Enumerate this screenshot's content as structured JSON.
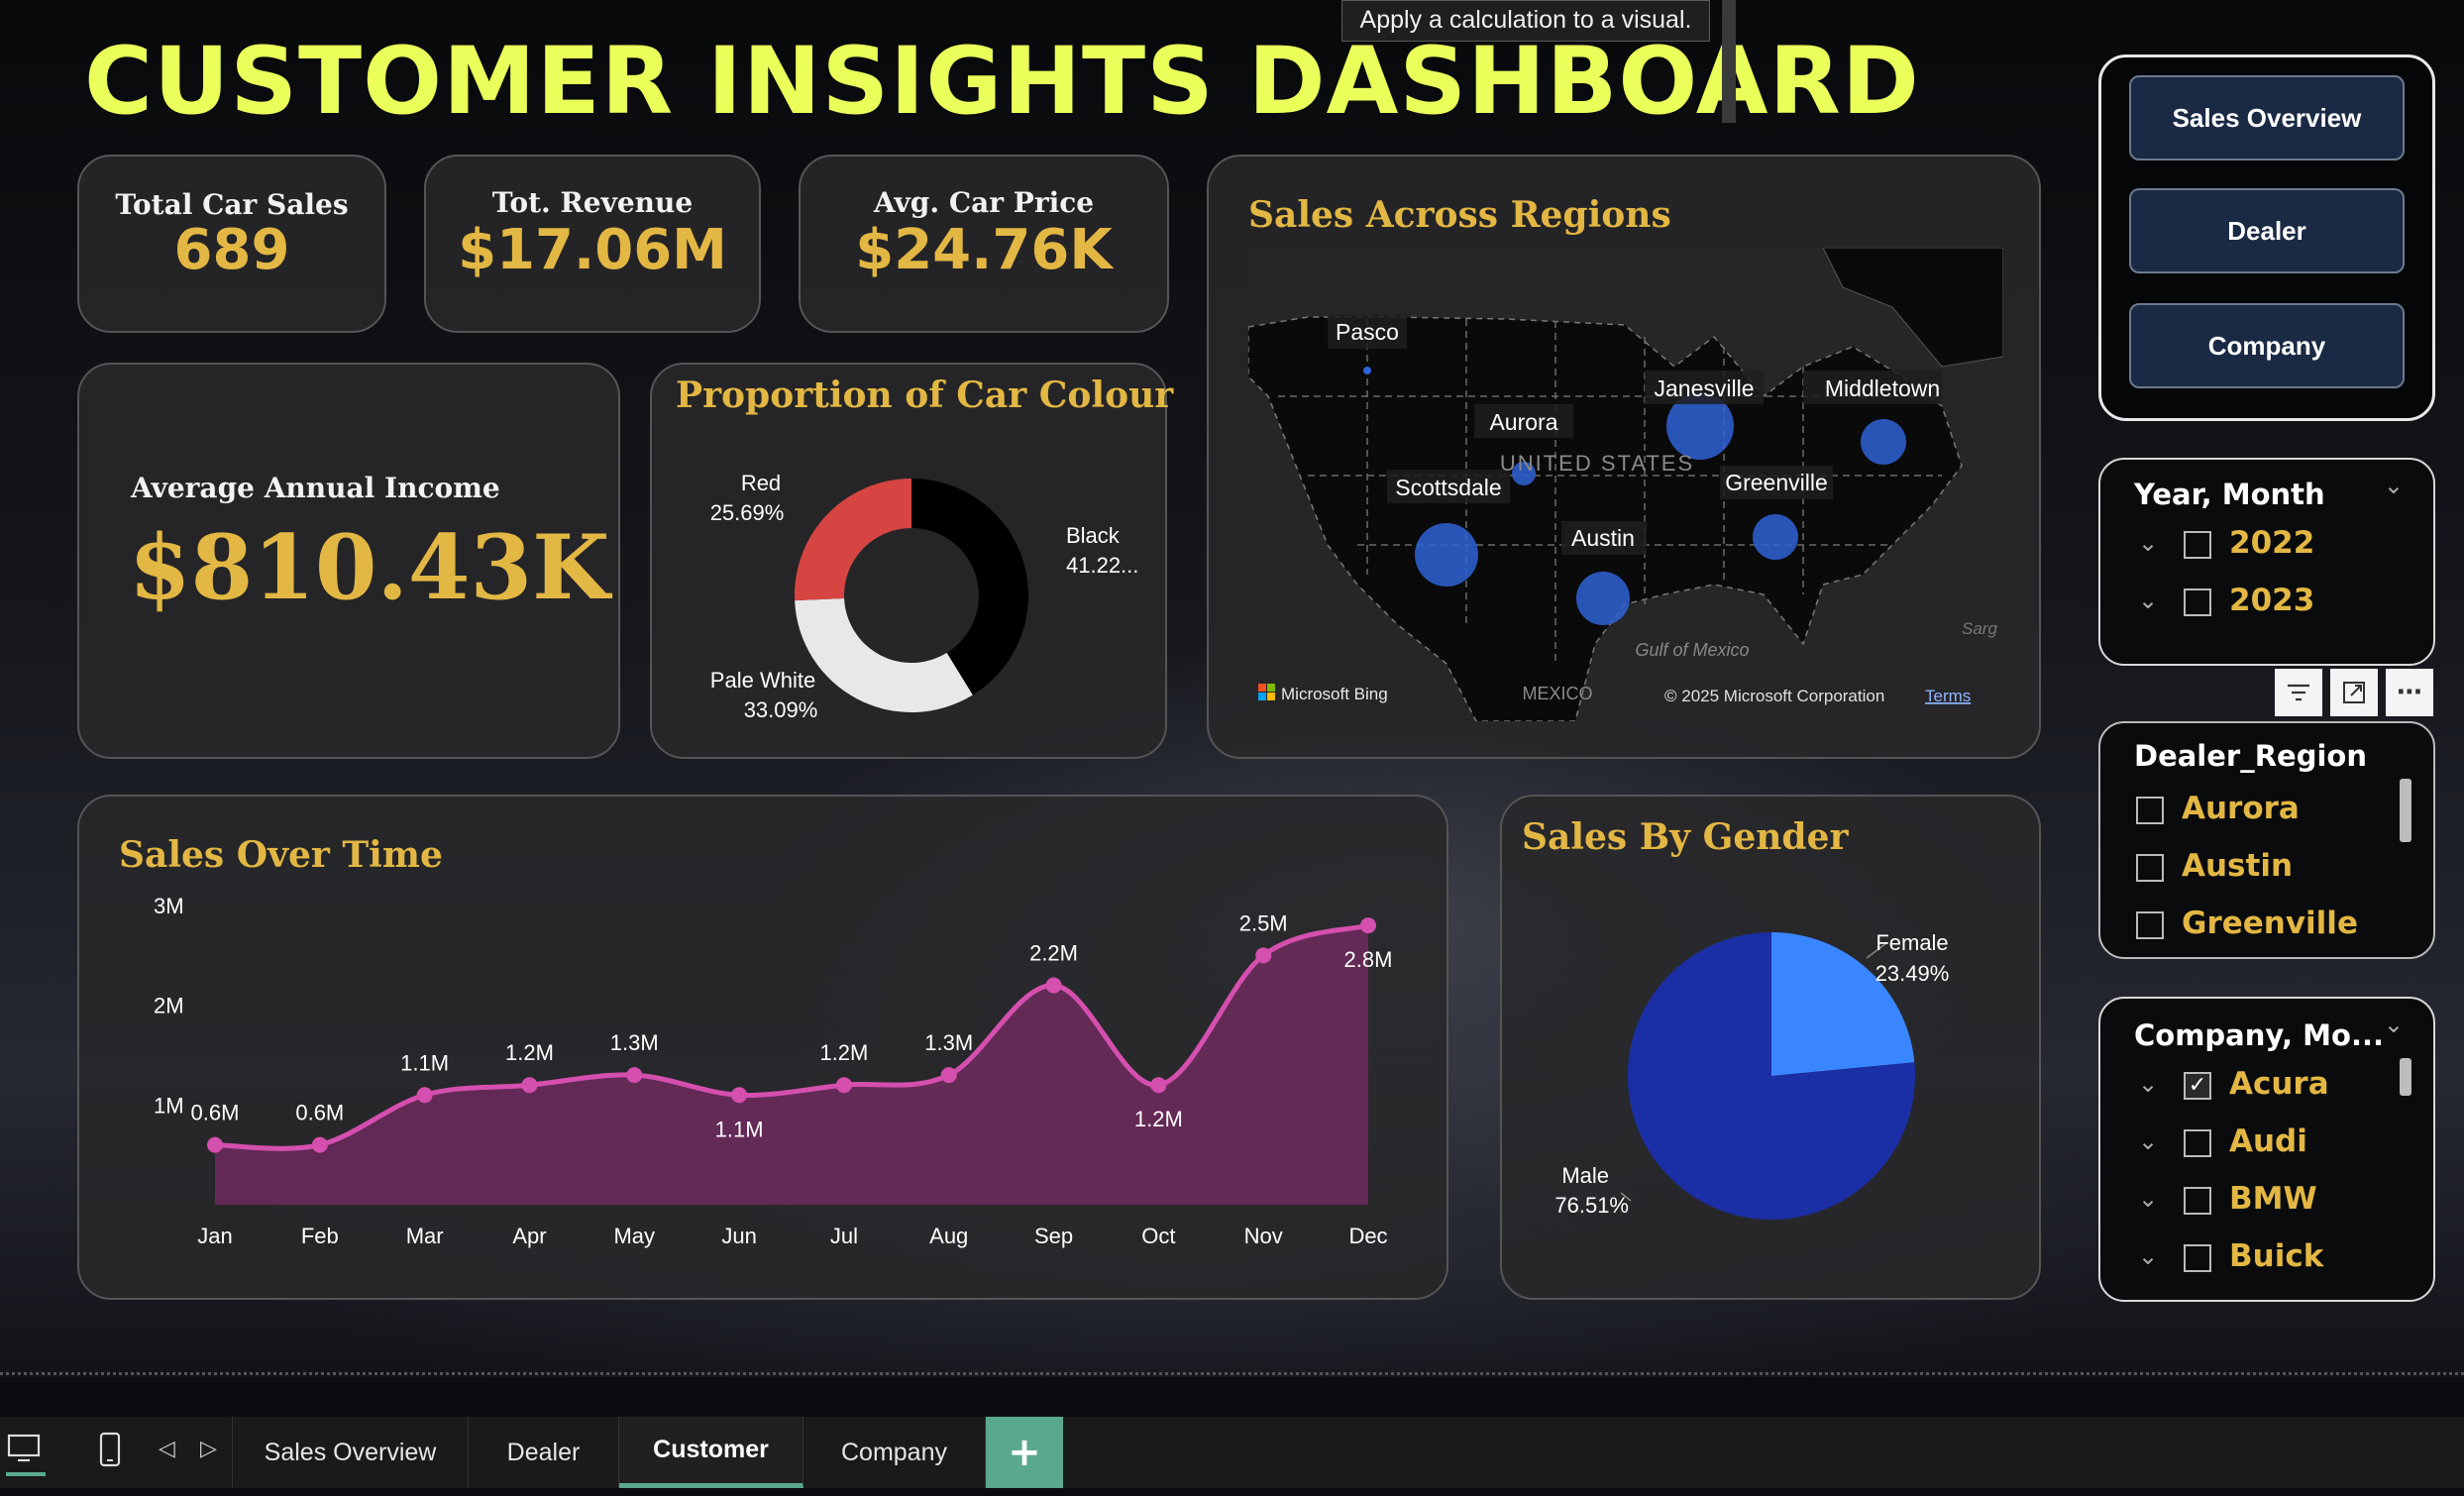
{
  "header": {
    "title": "CUSTOMER INSIGHTS DASHBOARD",
    "tooltip": "Apply a calculation to a visual."
  },
  "kpis": [
    {
      "label": "Total Car Sales",
      "value": "689"
    },
    {
      "label": "Tot. Revenue",
      "value": "$17.06M"
    },
    {
      "label": "Avg. Car Price",
      "value": "$24.76K"
    }
  ],
  "income": {
    "label": "Average Annual Income",
    "value": "$810.43K"
  },
  "colour_chart": {
    "title": "Proportion of Car Colour",
    "labels": [
      {
        "name": "Red",
        "value": "25.69%"
      },
      {
        "name": "Black",
        "value": "41.22..."
      },
      {
        "name": "Pale White",
        "value": "33.09%"
      }
    ]
  },
  "map": {
    "title": "Sales Across Regions",
    "cities": [
      "Pasco",
      "Janesville",
      "Middletown",
      "Aurora",
      "Scottsdale",
      "Greenville",
      "Austin"
    ],
    "country_label": "UNITED STATES",
    "gulf_label": "Gulf of Mexico",
    "mexico_label": "MEXICO",
    "sarg_label": "Sarg",
    "bing_label": "Microsoft Bing",
    "copyright": "© 2025 Microsoft Corporation",
    "terms": "Terms",
    "bubble_color": "#2f63d6"
  },
  "sales_time": {
    "title": "Sales Over Time",
    "line_color": "#d44fae",
    "area_color": "#6e2a5e"
  },
  "gender": {
    "title": "Sales By Gender",
    "labels": [
      {
        "name": "Female",
        "value": "23.49%"
      },
      {
        "name": "Male",
        "value": "76.51%"
      }
    ],
    "colors": {
      "female": "#3a86ff",
      "male": "#1a2fa5"
    }
  },
  "nav": {
    "buttons": [
      "Sales Overview",
      "Dealer",
      "Company"
    ]
  },
  "year_slicer": {
    "title": "Year, Month",
    "items": [
      "2022",
      "2023"
    ]
  },
  "region_slicer": {
    "title": "Dealer_Region",
    "items": [
      "Aurora",
      "Austin",
      "Greenville"
    ]
  },
  "company_slicer": {
    "title": "Company, Mo...",
    "items": [
      "Acura",
      "Audi",
      "BMW",
      "Buick"
    ],
    "checked": "Acura"
  },
  "visual_header_icons": [
    "filter-icon",
    "focus-mode-icon",
    "more-options-icon"
  ],
  "tabs": {
    "pages": [
      "Sales Overview",
      "Dealer",
      "Customer",
      "Company"
    ],
    "active": "Customer",
    "add": "+",
    "icons": [
      "desktop-view-icon",
      "mobile-view-icon",
      "prev-page-icon",
      "next-page-icon"
    ]
  },
  "chart_data": [
    {
      "type": "line",
      "title": "Sales Over Time",
      "categories": [
        "Jan",
        "Feb",
        "Mar",
        "Apr",
        "May",
        "Jun",
        "Jul",
        "Aug",
        "Sep",
        "Oct",
        "Nov",
        "Dec"
      ],
      "values": [
        0.6,
        0.6,
        1.1,
        1.2,
        1.3,
        1.1,
        1.2,
        1.3,
        2.2,
        1.2,
        2.5,
        2.8
      ],
      "data_labels": [
        "0.6M",
        "0.6M",
        "1.1M",
        "1.2M",
        "1.3M",
        "1.1M",
        "1.2M",
        "1.3M",
        "2.2M",
        "1.2M",
        "2.5M",
        "2.8M"
      ],
      "y_ticks": [
        "1M",
        "2M",
        "3M"
      ],
      "ylim": [
        0,
        3
      ],
      "grid": false,
      "unit": "M"
    },
    {
      "type": "pie",
      "variant": "donut",
      "title": "Proportion of Car Colour",
      "series": [
        {
          "name": "Black",
          "value": 41.22,
          "color": "#000000"
        },
        {
          "name": "Pale White",
          "value": 33.09,
          "color": "#e8e8e8"
        },
        {
          "name": "Red",
          "value": 25.69,
          "color": "#d64541"
        }
      ]
    },
    {
      "type": "pie",
      "title": "Sales By Gender",
      "series": [
        {
          "name": "Female",
          "value": 23.49,
          "color": "#3a86ff"
        },
        {
          "name": "Male",
          "value": 76.51,
          "color": "#1a2fa5"
        }
      ]
    }
  ]
}
